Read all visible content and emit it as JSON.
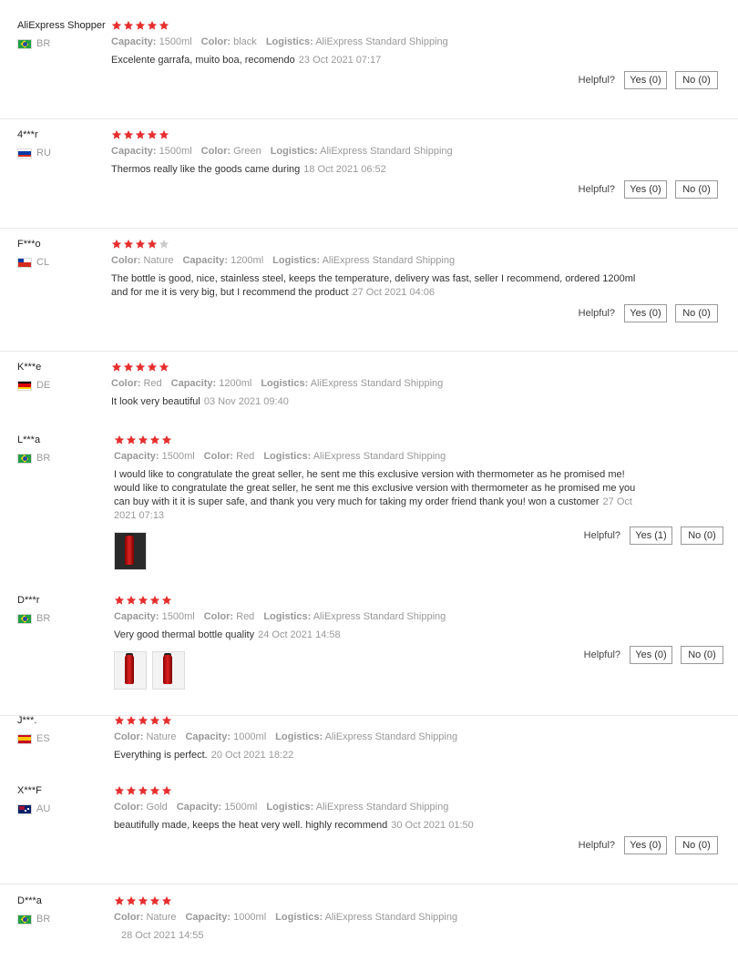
{
  "helpful_label": "Helpful?",
  "reviews": [
    {
      "user": "AliExpress Shopper",
      "country": "BR",
      "stars": 5,
      "attrs": [
        {
          "k": "Capacity:",
          "v": "1500ml"
        },
        {
          "k": "Color:",
          "v": "black"
        },
        {
          "k": "Logistics:",
          "v": "AliExpress Standard Shipping"
        }
      ],
      "text": "Excelente garrafa, muito boa, recomendo",
      "date": "23 Oct 2021 07:17",
      "yes": "Yes (0)",
      "no": "No (0)"
    },
    {
      "user": "4***r",
      "country": "RU",
      "stars": 5,
      "attrs": [
        {
          "k": "Capacity:",
          "v": "1500ml"
        },
        {
          "k": "Color:",
          "v": "Green"
        },
        {
          "k": "Logistics:",
          "v": "AliExpress Standard Shipping"
        }
      ],
      "text": "Thermos really like the goods came during",
      "date": "18 Oct 2021 06:52",
      "yes": "Yes (0)",
      "no": "No (0)"
    },
    {
      "user": "F***o",
      "country": "CL",
      "stars": 4,
      "attrs": [
        {
          "k": "Color:",
          "v": "Nature"
        },
        {
          "k": "Capacity:",
          "v": "1200ml"
        },
        {
          "k": "Logistics:",
          "v": "AliExpress Standard Shipping"
        }
      ],
      "text": "The bottle is good, nice, stainless steel, keeps the temperature, delivery was fast, seller I recommend, ordered 1200ml and for me it is very big, but I recommend the product",
      "date": "27 Oct 2021 04:06",
      "yes": "Yes (0)",
      "no": "No (0)"
    },
    {
      "user": "K***e",
      "country": "DE",
      "stars": 5,
      "attrs": [
        {
          "k": "Color:",
          "v": "Red"
        },
        {
          "k": "Capacity:",
          "v": "1200ml"
        },
        {
          "k": "Logistics:",
          "v": "AliExpress Standard Shipping"
        }
      ],
      "text": "It look very beautiful",
      "date": "03 Nov 2021 09:40"
    },
    {
      "user": "L***a",
      "country": "BR",
      "stars": 5,
      "attrs": [
        {
          "k": "Capacity:",
          "v": "1500ml"
        },
        {
          "k": "Color:",
          "v": "Red"
        },
        {
          "k": "Logistics:",
          "v": "AliExpress Standard Shipping"
        }
      ],
      "text": "I would like to congratulate the great seller, he sent me this exclusive version with thermometer as he promised me! would like to congratulate the great seller, he sent me this exclusive version with thermometer as he promised me you can buy with it it is super safe, and thank you very much for taking my order friend thank you! won a customer",
      "date": "27 Oct 2021 07:13",
      "photos": 1,
      "yes": "Yes (1)",
      "no": "No (0)"
    },
    {
      "user": "D***r",
      "country": "BR",
      "stars": 5,
      "attrs": [
        {
          "k": "Capacity:",
          "v": "1500ml"
        },
        {
          "k": "Color:",
          "v": "Red"
        },
        {
          "k": "Logistics:",
          "v": "AliExpress Standard Shipping"
        }
      ],
      "text": "Very good thermal bottle quality",
      "date": "24 Oct 2021 14:58",
      "photos": 2,
      "yes": "Yes (0)",
      "no": "No (0)"
    },
    {
      "user": "J***.",
      "country": "ES",
      "stars": 5,
      "attrs": [
        {
          "k": "Color:",
          "v": "Nature"
        },
        {
          "k": "Capacity:",
          "v": "1000ml"
        },
        {
          "k": "Logistics:",
          "v": "AliExpress Standard Shipping"
        }
      ],
      "text": "Everything is perfect.",
      "date": "20 Oct 2021 18:22"
    },
    {
      "user": "X***F",
      "country": "AU",
      "stars": 5,
      "attrs": [
        {
          "k": "Color:",
          "v": "Gold"
        },
        {
          "k": "Capacity:",
          "v": "1500ml"
        },
        {
          "k": "Logistics:",
          "v": "AliExpress Standard Shipping"
        }
      ],
      "text": "beautifully made, keeps the heat very well. highly recommend",
      "date": "30 Oct 2021 01:50",
      "yes": "Yes (0)",
      "no": "No (0)"
    },
    {
      "user": "D***a",
      "country": "BR",
      "stars": 5,
      "attrs": [
        {
          "k": "Color:",
          "v": "Nature"
        },
        {
          "k": "Capacity:",
          "v": "1000ml"
        },
        {
          "k": "Logistics:",
          "v": "AliExpress Standard Shipping"
        }
      ],
      "text": "",
      "date": "28 Oct 2021 14:55"
    }
  ],
  "colors": {
    "star_on": "#e62e2e",
    "star_off": "#cccccc"
  }
}
